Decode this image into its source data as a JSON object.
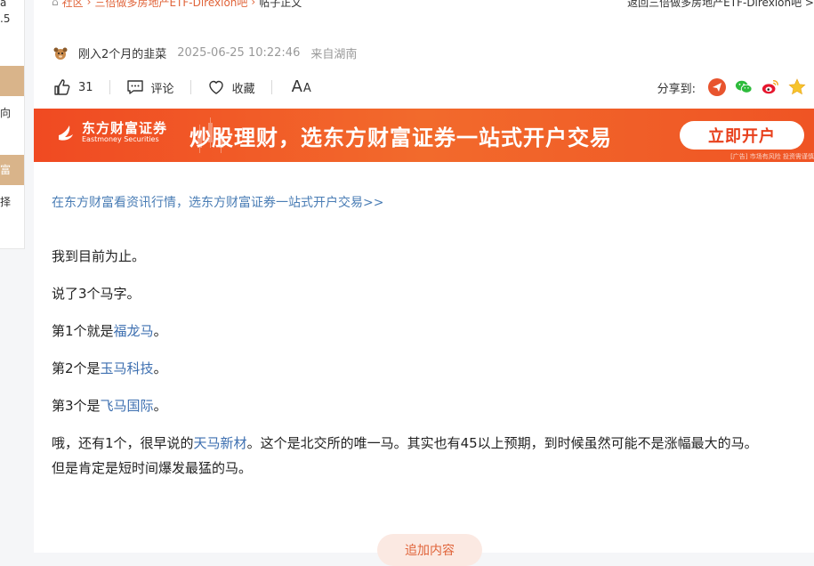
{
  "left_sidebar": {
    "fragments": [
      "a",
      ".5",
      "向",
      "富",
      "择"
    ]
  },
  "breadcrumb": {
    "home": "社区",
    "items": [
      "三倍做多房地产ETF-Direxion吧",
      "帖子正文"
    ]
  },
  "back_link": "返回三倍做多房地产ETF-Direxion吧 >",
  "author": {
    "name": "刚入2个月的韭菜",
    "time": "2025-06-25 10:22:46",
    "location": "来自湖南"
  },
  "actions": {
    "like_count": "31",
    "comment_label": "评论",
    "favorite_label": "收藏",
    "font_big": "A",
    "font_small": "A",
    "share_label": "分享到:"
  },
  "banner": {
    "logo_cn": "东方财富证券",
    "logo_en": "Eastmoney Securities",
    "slogan": "炒股理财，选东方财富证券一站式开户交易",
    "button": "立即开户",
    "ad_tag": "[广告] 市场有风险 投资需谨慎"
  },
  "promo_link": "在东方财富看资讯行情，选东方财富证券一站式开户交易>>",
  "post": {
    "p1": "我到目前为止。",
    "p2": "说了3个马字。",
    "p3_prefix": "第1个就是",
    "p3_link": "福龙马",
    "p3_suffix": "。",
    "p4_prefix": "第2个是",
    "p4_link": "玉马科技",
    "p4_suffix": "。",
    "p5_prefix": "第3个是",
    "p5_link": "飞马国际",
    "p5_suffix": "。",
    "p6_prefix": "哦，还有1个，很早说的",
    "p6_link": "天马新材",
    "p6_suffix": "。这个是北交所的唯一马。其实也有45以上预期，到时候虽然可能不是涨幅最大的马。",
    "p7": "但是肯定是短时间爆发最猛的马。"
  },
  "append_button": "追加内容",
  "colors": {
    "accent": "#e0643a",
    "link": "#3d6fb0",
    "banner": "#f04a22"
  }
}
